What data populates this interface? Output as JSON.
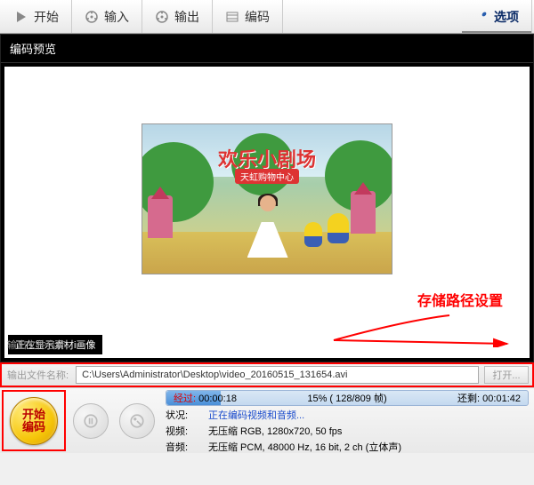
{
  "toolbar": {
    "start": "开始",
    "input": "输入",
    "output": "输出",
    "encode": "编码",
    "options": "选项"
  },
  "preview": {
    "title": "编码预览",
    "banner": "欢乐小剧场",
    "subbanner": "天虹购物中心",
    "material_badge": "正在显示素材i画像"
  },
  "annotation": {
    "storage_label": "存储路径设置"
  },
  "path": {
    "left_label": "输出文件名称:",
    "value": "C:\\Users\\Administrator\\Desktop\\video_20160515_131654.avi",
    "open_label": "打开..."
  },
  "controls": {
    "start_encode_l1": "开始",
    "start_encode_l2": "编码"
  },
  "progress": {
    "elapsed_key": "经过:",
    "elapsed_val": "00:00:18",
    "percent_text": "15% ( 128/809 帧)",
    "remain_key": "还剩:",
    "remain_val": "00:01:42",
    "fill_percent": 15
  },
  "info": {
    "status_key": "状况:",
    "status_val": "正在编码视频和音频...",
    "video_key": "视频:",
    "video_val": "无压缩 RGB, 1280x720, 50 fps",
    "audio_key": "音频:",
    "audio_val": "无压缩 PCM, 48000 Hz, 16 bit, 2 ch (立体声)"
  }
}
